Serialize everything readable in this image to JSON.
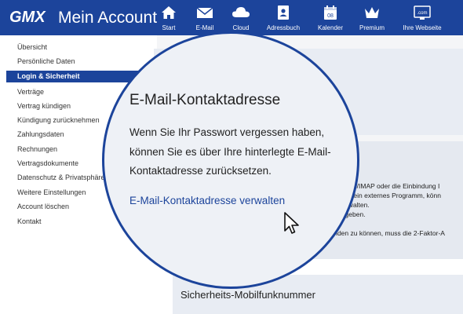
{
  "header": {
    "logo": "GMX",
    "title": "Mein Account",
    "nav": [
      {
        "label": "Start",
        "icon": "home-icon"
      },
      {
        "label": "E-Mail",
        "icon": "mail-icon"
      },
      {
        "label": "Cloud",
        "icon": "cloud-icon"
      },
      {
        "label": "Adressbuch",
        "icon": "addressbook-icon"
      },
      {
        "label": "Kalender",
        "icon": "calendar-icon",
        "day": "08"
      },
      {
        "label": "Premium",
        "icon": "crown-icon"
      },
      {
        "label": "Ihre Webseite",
        "icon": "website-icon",
        "badge": ".com"
      }
    ]
  },
  "sidebar": {
    "items": [
      "Übersicht",
      "Persönliche Daten",
      "Login & Sicherheit",
      "Verträge",
      "Vertrag kündigen",
      "Kündigung zurücknehmen",
      "Zahlungsdaten",
      "Rechnungen",
      "Vertragsdokumente",
      "Datenschutz & Privatsphäre",
      "Weitere Einstellungen",
      "Account löschen",
      "Kontakt"
    ],
    "active_index": 2
  },
  "background": {
    "lines": [
      "POP3/IMAP oder die Einbindung I",
      "v) in ein externes Programm, könn",
      "verwalten.",
      "ergeben.",
      "twenden zu können, muss die 2-Faktor-A"
    ],
    "section_title": "Sicherheits-Mobilfunknummer"
  },
  "magnifier": {
    "title": "E-Mail-Kontaktadresse",
    "text_lines": [
      "Wenn Sie Ihr Passwort vergessen haben,",
      "können Sie es über Ihre hinterlegte E-Mail-",
      "Kontaktadresse  zurücksetzen."
    ],
    "link": "E-Mail-Kontaktadresse verwalten"
  },
  "colors": {
    "brand": "#1c449b",
    "link": "#1c449b",
    "card": "#e8ecf3",
    "page": "#f4f5f7"
  }
}
